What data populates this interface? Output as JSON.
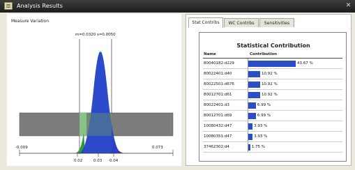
{
  "window": {
    "title": "Analysis Results",
    "close_glyph": "✕"
  },
  "left_panel": {
    "label": "Measure Variation",
    "stats_text": "m=0.0320 s=0.0050",
    "x_axis_labels": [
      "-0.009",
      "0.073"
    ],
    "sigma_labels": [
      "0.02",
      "0.03",
      "0.04"
    ],
    "colors": {
      "bell": "#2644c8",
      "tail_left": "#2e9a3a",
      "tail_right": "#cc1a1a",
      "band": "#7c7c7c",
      "band_left": "#9fe39f"
    }
  },
  "tabs": [
    {
      "label": "Stat Contribs",
      "active": true
    },
    {
      "label": "WC Contribs",
      "active": false
    },
    {
      "label": "Sensitivities",
      "active": false
    }
  ],
  "stat_contribs": {
    "title": "Statistical Contribution",
    "col_name": "Name",
    "col_contribution": "Contribution",
    "bar_color": "#2a4ec8",
    "rows": [
      {
        "name": "80040182:d229",
        "value": 43.67,
        "label": "43.67 %"
      },
      {
        "name": "80022401:d40",
        "value": 10.92,
        "label": "10.92 %"
      },
      {
        "name": "80022501:d676",
        "value": 10.92,
        "label": "10.92 %"
      },
      {
        "name": "80012701:d61",
        "value": 10.92,
        "label": "10.92 %"
      },
      {
        "name": "80022401:d3",
        "value": 6.99,
        "label": "6.99 %"
      },
      {
        "name": "80012701:d69",
        "value": 6.99,
        "label": "6.99 %"
      },
      {
        "name": "10080432:d47",
        "value": 3.93,
        "label": "3.93 %"
      },
      {
        "name": "10080351:d47",
        "value": 3.93,
        "label": "3.93 %"
      },
      {
        "name": "37462302:d4",
        "value": 1.75,
        "label": "1.75 %"
      }
    ]
  }
}
